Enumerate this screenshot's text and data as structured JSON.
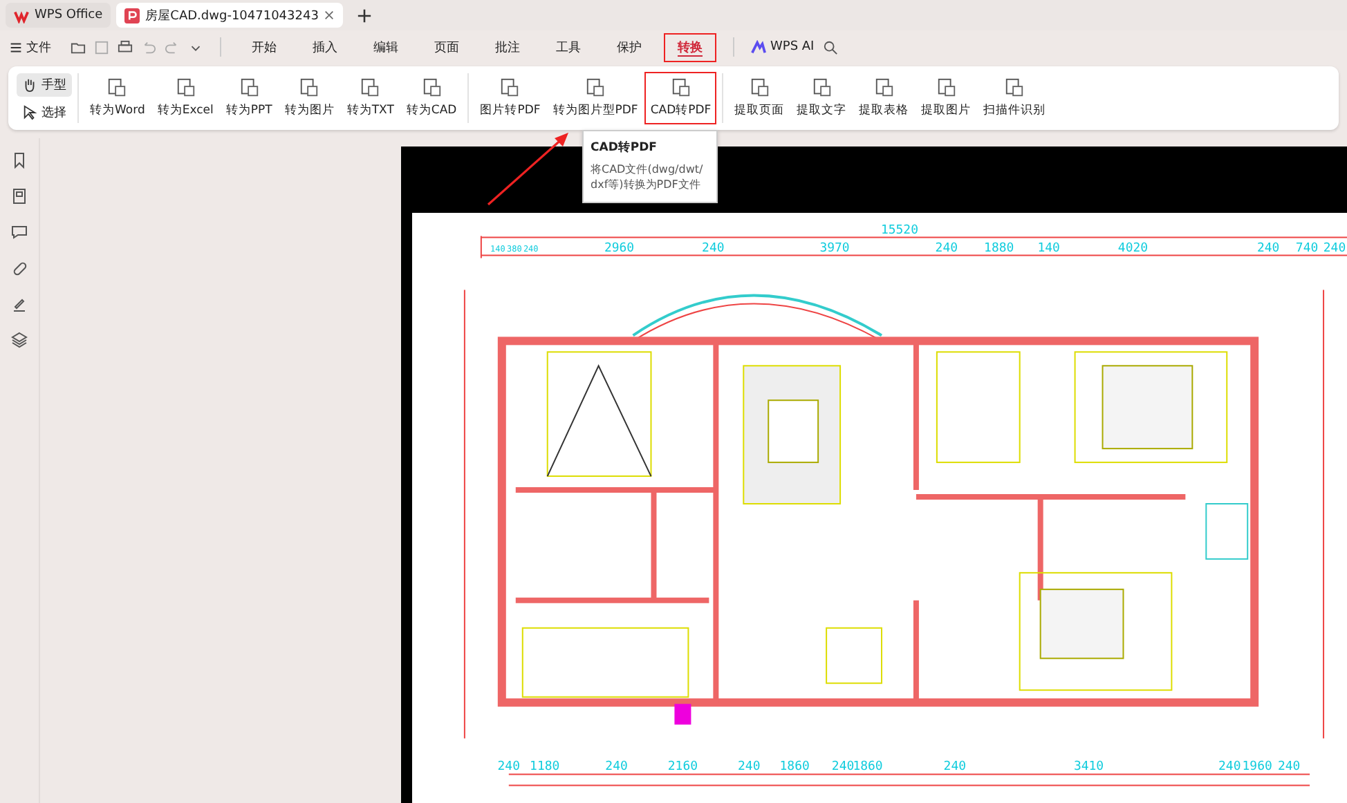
{
  "title_bar": {
    "tabs": [
      {
        "label": "WPS Office",
        "kind": "home",
        "selected": false
      },
      {
        "label": "房屋CAD.dwg-10471043243",
        "kind": "doc",
        "selected": true
      }
    ]
  },
  "menu": {
    "file": "文件",
    "tabs": [
      {
        "label": "开始",
        "selected": false,
        "annotated": false
      },
      {
        "label": "插入",
        "selected": false,
        "annotated": false
      },
      {
        "label": "编辑",
        "selected": false,
        "annotated": false
      },
      {
        "label": "页面",
        "selected": false,
        "annotated": false
      },
      {
        "label": "批注",
        "selected": false,
        "annotated": false
      },
      {
        "label": "工具",
        "selected": false,
        "annotated": false
      },
      {
        "label": "保护",
        "selected": false,
        "annotated": false
      },
      {
        "label": "转换",
        "selected": true,
        "annotated": true
      }
    ],
    "ai": "WPS AI"
  },
  "ribbon": {
    "modes": [
      {
        "label": "手型",
        "kind": "hand",
        "selected": true
      },
      {
        "label": "选择",
        "kind": "pointer",
        "selected": false
      }
    ],
    "groups": [
      [
        {
          "label": "转为Word",
          "annotated": false
        },
        {
          "label": "转为Excel",
          "annotated": false
        },
        {
          "label": "转为PPT",
          "annotated": false
        },
        {
          "label": "转为图片",
          "annotated": false
        },
        {
          "label": "转为TXT",
          "annotated": false
        },
        {
          "label": "转为CAD",
          "annotated": false
        }
      ],
      [
        {
          "label": "图片转PDF",
          "annotated": false
        },
        {
          "label": "转为图片型PDF",
          "annotated": false
        },
        {
          "label": "CAD转PDF",
          "annotated": true
        }
      ],
      [
        {
          "label": "提取页面",
          "annotated": false
        },
        {
          "label": "提取文字",
          "annotated": false
        },
        {
          "label": "提取表格",
          "annotated": false
        },
        {
          "label": "提取图片",
          "annotated": false
        },
        {
          "label": "扫描件识别",
          "annotated": false
        }
      ]
    ]
  },
  "tooltip": {
    "title": "CAD转PDF",
    "text": "将CAD文件(dwg/dwt/dxf等)转换为PDF文件"
  },
  "plan": {
    "total": "15520",
    "top_dims": [
      "140",
      "380",
      "240",
      "2960",
      "240",
      "3970",
      "240",
      "1880",
      "140",
      "4020",
      "240",
      "740",
      "240"
    ],
    "bottom_dims": [
      "240",
      "1180",
      "240",
      "2160",
      "240",
      "1860",
      "240",
      "1860",
      "240",
      "3410",
      "240",
      "1960",
      "240"
    ]
  }
}
